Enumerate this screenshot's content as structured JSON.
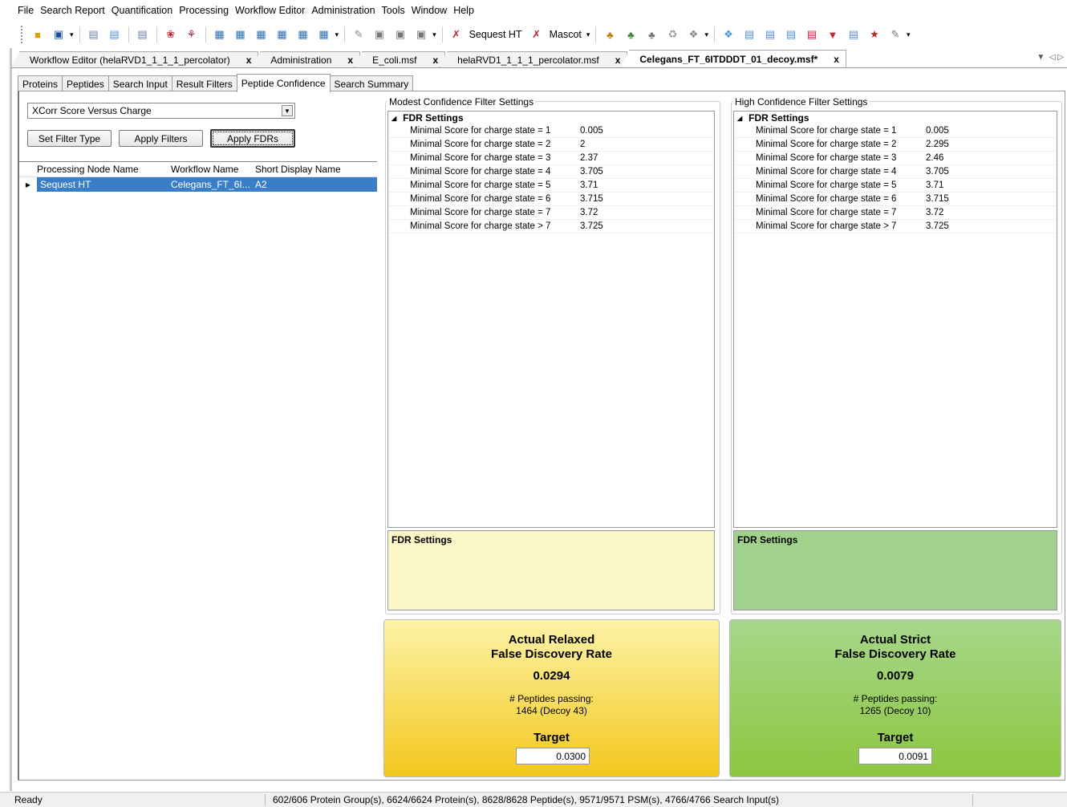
{
  "menu": [
    "File",
    "Search Report",
    "Quantification",
    "Processing",
    "Workflow Editor",
    "Administration",
    "Tools",
    "Window",
    "Help"
  ],
  "toolbar": {
    "sequest_label": "Sequest HT",
    "mascot_label": "Mascot"
  },
  "doc_tabs": [
    {
      "label": "Workflow Editor (helaRVD1_1_1_1_percolator)",
      "close": "x"
    },
    {
      "label": "Administration",
      "close": "x"
    },
    {
      "label": "E_coli.msf",
      "close": "x"
    },
    {
      "label": "helaRVD1_1_1_1_percolator.msf",
      "close": "x"
    },
    {
      "label": "Celegans_FT_6ITDDDT_01_decoy.msf*",
      "close": "x"
    }
  ],
  "sub_tabs": [
    "Proteins",
    "Peptides",
    "Search Input",
    "Result Filters",
    "Peptide Confidence",
    "Search Summary"
  ],
  "left": {
    "filter_type_value": "XCorr Score Versus Charge",
    "set_filter_type": "Set Filter Type",
    "apply_filters": "Apply Filters",
    "apply_fdrs": "Apply FDRs",
    "columns": [
      "Processing Node Name",
      "Workflow Name",
      "Short Display Name"
    ],
    "rows": [
      {
        "node": "Sequest HT",
        "workflow": "Celegans_FT_6I...",
        "short": "A2"
      }
    ]
  },
  "modest": {
    "group_title": "Modest Confidence Filter Settings",
    "category": "FDR Settings",
    "rows": [
      {
        "name": "Minimal Score for charge state = 1",
        "value": "0.005"
      },
      {
        "name": "Minimal Score for charge state = 2",
        "value": "2"
      },
      {
        "name": "Minimal Score for charge state = 3",
        "value": "2.37"
      },
      {
        "name": "Minimal Score for charge state = 4",
        "value": "3.705"
      },
      {
        "name": "Minimal Score for charge state = 5",
        "value": "3.71"
      },
      {
        "name": "Minimal Score for charge state = 6",
        "value": "3.715"
      },
      {
        "name": "Minimal Score for charge state = 7",
        "value": "3.72"
      },
      {
        "name": "Minimal Score for charge state > 7",
        "value": "3.725"
      }
    ],
    "desc_title": "FDR Settings",
    "panel": {
      "title_line1": "Actual Relaxed",
      "title_line2": "False Discovery Rate",
      "rate": "0.0294",
      "passing_label": "# Peptides passing:",
      "passing_value": "1464 (Decoy 43)",
      "target_label": "Target",
      "target_value": "0.0300"
    }
  },
  "high": {
    "group_title": "High Confidence Filter Settings",
    "category": "FDR Settings",
    "rows": [
      {
        "name": "Minimal Score for charge state = 1",
        "value": "0.005"
      },
      {
        "name": "Minimal Score for charge state = 2",
        "value": "2.295"
      },
      {
        "name": "Minimal Score for charge state = 3",
        "value": "2.46"
      },
      {
        "name": "Minimal Score for charge state = 4",
        "value": "3.705"
      },
      {
        "name": "Minimal Score for charge state = 5",
        "value": "3.71"
      },
      {
        "name": "Minimal Score for charge state = 6",
        "value": "3.715"
      },
      {
        "name": "Minimal Score for charge state = 7",
        "value": "3.72"
      },
      {
        "name": "Minimal Score for charge state > 7",
        "value": "3.725"
      }
    ],
    "desc_title": "FDR Settings",
    "panel": {
      "title_line1": "Actual Strict",
      "title_line2": "False Discovery Rate",
      "rate": "0.0079",
      "passing_label": "# Peptides passing:",
      "passing_value": "1265 (Decoy 10)",
      "target_label": "Target",
      "target_value": "0.0091"
    }
  },
  "status": {
    "ready": "Ready",
    "summary": "602/606 Protein Group(s), 6624/6624 Protein(s), 8628/8628 Peptide(s), 9571/9571 PSM(s), 4766/4766 Search Input(s)"
  },
  "colors": {
    "selection": "#3a7ec8",
    "relaxed_panel_top": "#fdf3a8",
    "relaxed_panel_bottom": "#f3c71c",
    "strict_panel_top": "#a6d78a",
    "strict_panel_bottom": "#8cc63f",
    "relaxed_desc": "#fbf6c8",
    "strict_desc": "#a1d28b"
  }
}
